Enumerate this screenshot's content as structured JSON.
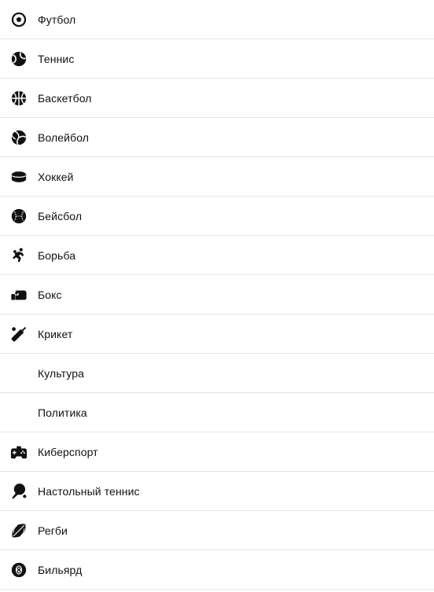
{
  "menu": {
    "items": [
      {
        "label": "Футбол",
        "icon": "soccer-ball-icon"
      },
      {
        "label": "Теннис",
        "icon": "tennis-ball-icon"
      },
      {
        "label": "Баскетбол",
        "icon": "basketball-icon"
      },
      {
        "label": "Волейбол",
        "icon": "volleyball-icon"
      },
      {
        "label": "Хоккей",
        "icon": "hockey-puck-icon"
      },
      {
        "label": "Бейсбол",
        "icon": "baseball-icon"
      },
      {
        "label": "Борьба",
        "icon": "wrestling-icon"
      },
      {
        "label": "Бокс",
        "icon": "boxing-glove-icon"
      },
      {
        "label": "Крикет",
        "icon": "cricket-bat-icon"
      },
      {
        "label": "Культура",
        "icon": ""
      },
      {
        "label": "Политика",
        "icon": ""
      },
      {
        "label": "Киберспорт",
        "icon": "gamepad-icon"
      },
      {
        "label": "Настольный теннис",
        "icon": "table-tennis-icon"
      },
      {
        "label": "Регби",
        "icon": "rugby-ball-icon"
      },
      {
        "label": "Бильярд",
        "icon": "billiard-ball-icon"
      }
    ]
  },
  "colors": {
    "text": "#111111",
    "divider": "#e4e4e4",
    "background": "#ffffff",
    "icon": "#111111"
  }
}
